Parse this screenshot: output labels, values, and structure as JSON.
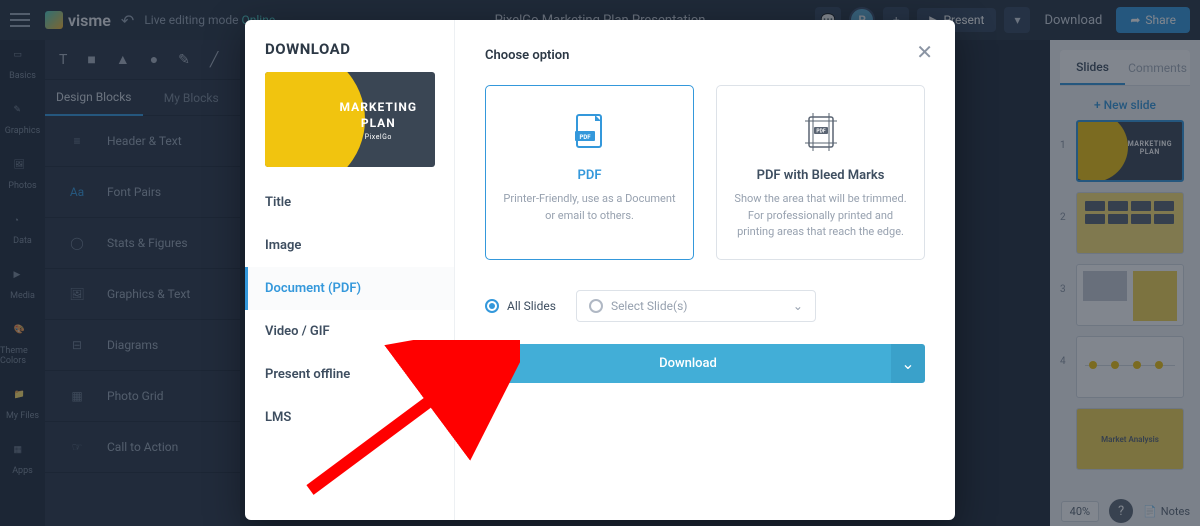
{
  "topbar": {
    "brand": "visme",
    "live_editing": "Live editing mode",
    "online": "Online",
    "doc_title": "PixelGo Marketing Plan Presentation",
    "avatar_initial": "R",
    "present": "Present",
    "download": "Download",
    "share": "Share"
  },
  "left_rail": [
    {
      "label": "Basics"
    },
    {
      "label": "Graphics"
    },
    {
      "label": "Photos"
    },
    {
      "label": "Data"
    },
    {
      "label": "Media"
    },
    {
      "label": "Theme Colors"
    },
    {
      "label": "My Files"
    },
    {
      "label": "Apps"
    }
  ],
  "design_tabs": {
    "active": "Design Blocks",
    "inactive": "My Blocks"
  },
  "blocks": [
    "Header & Text",
    "Font Pairs",
    "Stats & Figures",
    "Graphics & Text",
    "Diagrams",
    "Photo Grid",
    "Call to Action"
  ],
  "right_panel": {
    "tab_slides": "Slides",
    "tab_comments": "Comments",
    "new_slide": "+ New slide",
    "notes": "Notes",
    "zoom": "40%",
    "slide5_label": "Market Analysis"
  },
  "preview": {
    "title": "MARKETING",
    "subtitle": "PLAN",
    "brand_small": "PixelGo"
  },
  "modal": {
    "title": "DOWNLOAD",
    "nav": [
      "Title",
      "Image",
      "Document (PDF)",
      "Video / GIF",
      "Present offline",
      "LMS"
    ],
    "choose": "Choose option",
    "opt1_title": "PDF",
    "opt1_desc": "Printer-Friendly, use as a Document or email to others.",
    "opt2_title": "PDF with Bleed Marks",
    "opt2_desc": "Show the area that will be trimmed. For professionally printed and printing areas that reach the edge.",
    "all_slides": "All Slides",
    "select_slides": "Select Slide(s)",
    "download_btn": "Download"
  }
}
